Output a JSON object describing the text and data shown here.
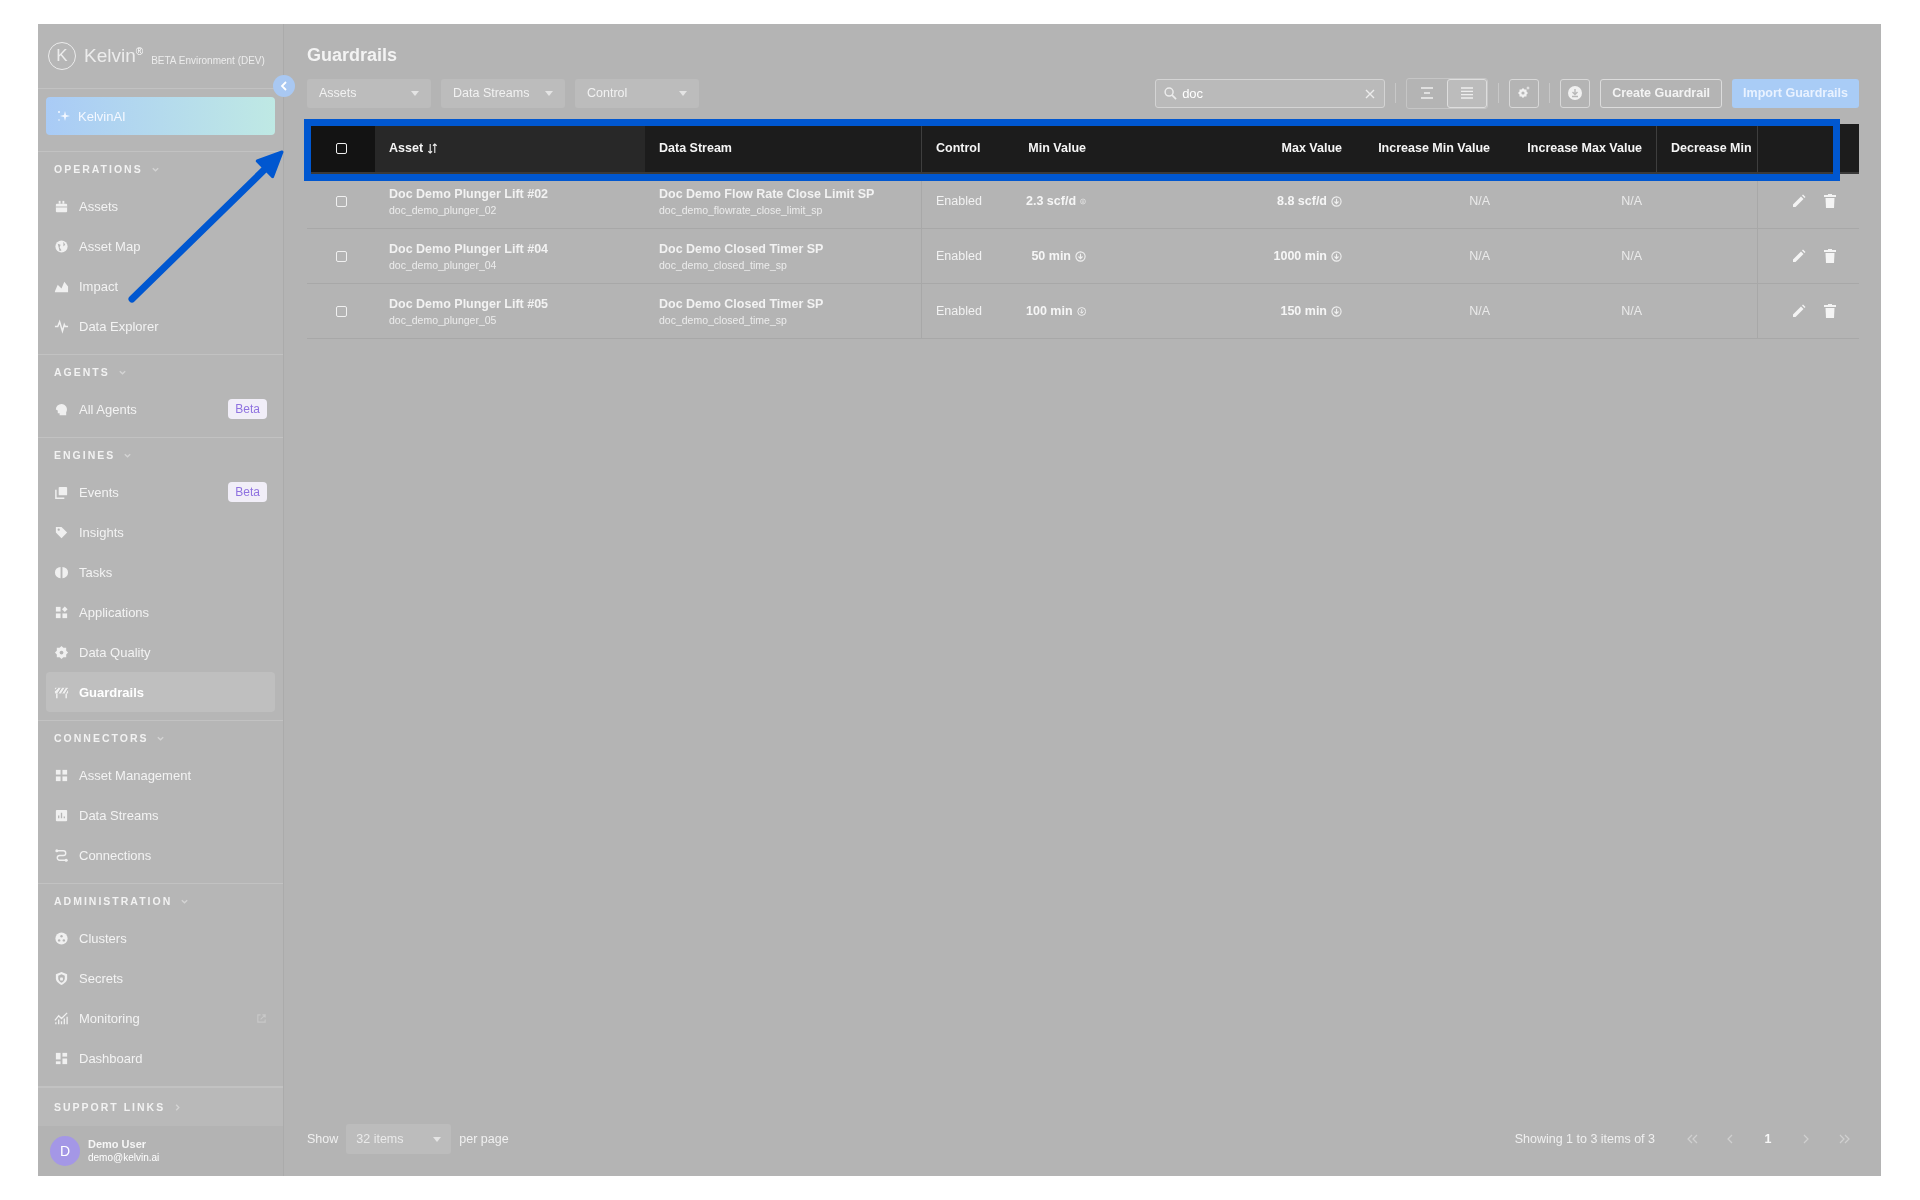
{
  "brand": {
    "logo_mark": "K",
    "name": "Kelvin$^{®}$",
    "environment": "BETA Environment (DEV)"
  },
  "assistant": {
    "label": "KelvinAI"
  },
  "sidebar": {
    "sections": [
      {
        "title": "OPERATIONS",
        "expanded": true,
        "items": [
          {
            "label": "Assets",
            "selected": false
          },
          {
            "label": "Asset Map",
            "selected": false
          },
          {
            "label": "Impact",
            "selected": false
          },
          {
            "label": "Data Explorer",
            "selected": false
          }
        ]
      },
      {
        "title": "AGENTS",
        "expanded": true,
        "items": [
          {
            "label": "All Agents",
            "badge": "Beta",
            "selected": false
          }
        ]
      },
      {
        "title": "ENGINES",
        "expanded": true,
        "items": [
          {
            "label": "Events",
            "badge": "Beta",
            "selected": false
          },
          {
            "label": "Insights",
            "selected": false
          },
          {
            "label": "Tasks",
            "selected": false
          },
          {
            "label": "Applications",
            "selected": false
          },
          {
            "label": "Data Quality",
            "selected": false
          },
          {
            "label": "Guardrails",
            "selected": true
          }
        ]
      },
      {
        "title": "CONNECTORS",
        "expanded": true,
        "items": [
          {
            "label": "Asset Management",
            "selected": false
          },
          {
            "label": "Data Streams",
            "selected": false
          },
          {
            "label": "Connections",
            "selected": false
          }
        ]
      },
      {
        "title": "ADMINISTRATION",
        "expanded": true,
        "items": [
          {
            "label": "Clusters",
            "selected": false
          },
          {
            "label": "Secrets",
            "selected": false
          },
          {
            "label": "Monitoring",
            "external": true,
            "selected": false
          },
          {
            "label": "Dashboard",
            "selected": false
          }
        ]
      }
    ],
    "support": {
      "title": "SUPPORT LINKS",
      "expanded": false
    }
  },
  "user": {
    "initial": "D",
    "name": "Demo User",
    "email": "demo@kelvin.ai"
  },
  "page": {
    "title": "Guardrails"
  },
  "filters": [
    {
      "placeholder": "Assets"
    },
    {
      "placeholder": "Data Streams"
    },
    {
      "placeholder": "Control"
    }
  ],
  "search": {
    "value": "doc"
  },
  "view_toggles": [
    {
      "selected": false
    },
    {
      "selected": true
    }
  ],
  "buttons": [
    {
      "label": "Create Guardrail",
      "kind": "outline"
    },
    {
      "label": "Import Guardrails",
      "kind": "primary"
    }
  ],
  "table": {
    "select_all": {
      "checked": false
    },
    "columns": [
      {
        "label": "Asset",
        "sorted": true
      },
      {
        "label": "Data Stream",
        "sorted": false
      },
      {
        "label": "Control",
        "sorted": false
      },
      {
        "label": "Min Value",
        "sorted": false
      },
      {
        "label": "Max Value",
        "sorted": false
      },
      {
        "label": "Increase Min Value",
        "sorted": false
      },
      {
        "label": "Increase Max Value",
        "sorted": false
      },
      {
        "label": "Decrease Min",
        "sorted": false
      }
    ],
    "rows": [
      {
        "checked": false,
        "asset": "Doc Demo Plunger Lift #02",
        "asset_id": "doc_demo_plunger_02",
        "data_stream": "Doc Demo Flow Rate Close Limit SP",
        "data_stream_id": "doc_demo_flowrate_close_limit_sp",
        "control": "Enabled",
        "min_value": "2.3 scf/d",
        "max_value": "8.8 scf/d",
        "increase_min_value": "N/A",
        "increase_max_value": "N/A"
      },
      {
        "checked": false,
        "asset": "Doc Demo Plunger Lift #04",
        "asset_id": "doc_demo_plunger_04",
        "data_stream": "Doc Demo Closed Timer SP",
        "data_stream_id": "doc_demo_closed_time_sp",
        "control": "Enabled",
        "min_value": "50 min",
        "max_value": "1000 min",
        "increase_min_value": "N/A",
        "increase_max_value": "N/A"
      },
      {
        "checked": false,
        "asset": "Doc Demo Plunger Lift #05",
        "asset_id": "doc_demo_plunger_05",
        "data_stream": "Doc Demo Closed Timer SP",
        "data_stream_id": "doc_demo_closed_time_sp",
        "control": "Enabled",
        "min_value": "100 min",
        "max_value": "150 min",
        "increase_min_value": "N/A",
        "increase_max_value": "N/A"
      }
    ]
  },
  "pagination": {
    "show_label": "Show",
    "page_size": "32 items",
    "per_page_label": "per page",
    "summary": "Showing 1 to 3 items of 3",
    "pages": [
      {
        "label": "1",
        "selected": true
      }
    ]
  }
}
